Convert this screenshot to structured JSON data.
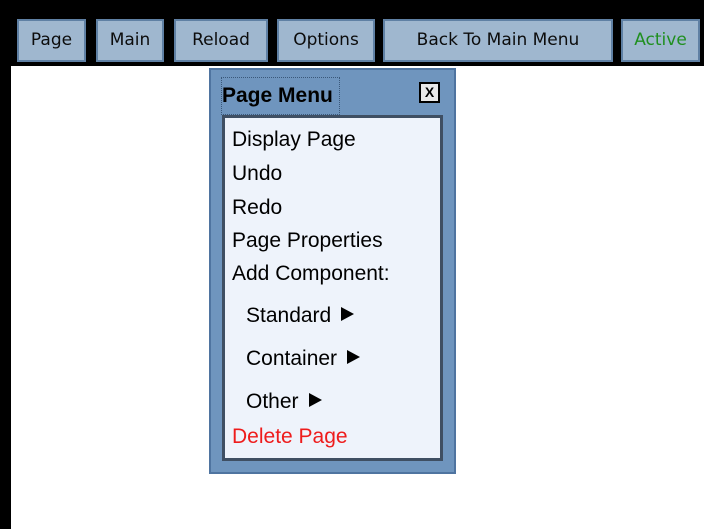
{
  "toolbar": {
    "tabs": [
      {
        "label": "Page"
      },
      {
        "label": "Main"
      },
      {
        "label": "Reload"
      },
      {
        "label": "Options"
      },
      {
        "label": "Back To Main Menu"
      },
      {
        "label": "Active"
      }
    ]
  },
  "page_menu": {
    "title": "Page Menu",
    "close_label": "X",
    "items": [
      {
        "label": "Display Page"
      },
      {
        "label": "Undo"
      },
      {
        "label": "Redo"
      },
      {
        "label": "Page Properties"
      },
      {
        "label": "Add Component:"
      }
    ],
    "submenus": [
      {
        "label": "Standard",
        "icon": "triangle-right-icon"
      },
      {
        "label": "Container",
        "icon": "triangle-right-icon"
      },
      {
        "label": "Other",
        "icon": "triangle-right-icon"
      }
    ],
    "delete_label": "Delete Page"
  },
  "colors": {
    "tab_bg": "#9fb7cf",
    "tab_border": "#5f80a4",
    "active_text": "#1f8f1f",
    "menu_frame": "#6f95be",
    "menu_body": "#eef3fb",
    "delete_text": "#ee1c1c"
  }
}
